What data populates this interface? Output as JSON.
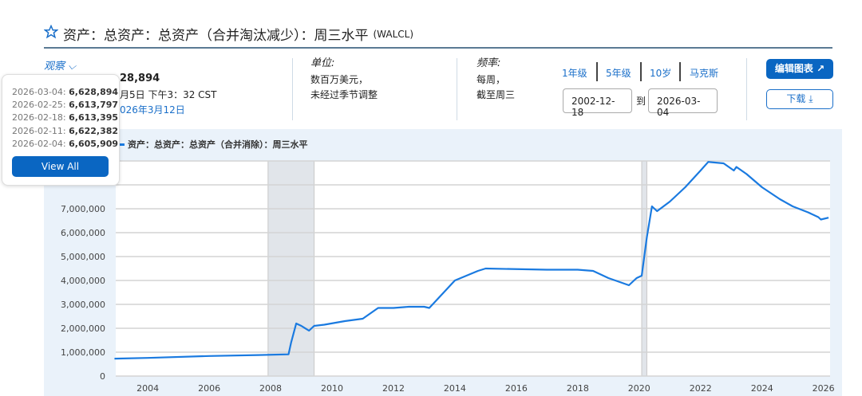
{
  "header": {
    "title": "资产：总资产：总资产（合并淘汰减少）：周三水平",
    "series_id": "(WALCL)",
    "star_icon": "star-outline-icon"
  },
  "observation": {
    "label": "观察",
    "latest_value_partial": "28,894",
    "updated_partial": "月5日 下午3：32 CST",
    "next_release_partial": "026年3月12日"
  },
  "units": {
    "label": "单位:",
    "line1": "数百万美元，",
    "line2": "未经过季节调整"
  },
  "frequency": {
    "label": "频率:",
    "line1": "每周，",
    "line2": "截至周三"
  },
  "ranges": [
    "1年级",
    "5年级",
    "10岁",
    "马克斯"
  ],
  "date_range": {
    "start": "2002-12-18",
    "to": "到",
    "end": "2026-03-04"
  },
  "buttons": {
    "edit": "编辑图表",
    "download": "下载"
  },
  "popup": {
    "rows": [
      {
        "date": "2026-03-04:",
        "value": "6,628,894"
      },
      {
        "date": "2026-02-25:",
        "value": "6,613,797"
      },
      {
        "date": "2026-02-18:",
        "value": "6,613,395"
      },
      {
        "date": "2026-02-11:",
        "value": "6,622,382"
      },
      {
        "date": "2026-02-04:",
        "value": "6,605,909"
      }
    ],
    "view_all": "View All"
  },
  "colors": {
    "accent": "#0a66c2",
    "line": "#1a7ae0",
    "recession": "#e1e5ea",
    "chart_bg": "#eaf2fa"
  },
  "chart_data": {
    "type": "line",
    "legend": "资产：总资产：总资产（合并消除）：周三水平",
    "legend_placement": "top-left",
    "grid": true,
    "xlim": [
      "2002-12",
      "2026-03"
    ],
    "ylim": [
      0,
      9000000
    ],
    "y_ticks": [
      "0",
      "1,000,000",
      "2,000,000",
      "3,000,000",
      "4,000,000",
      "5,000,000",
      "6,000,000",
      "7,000,000"
    ],
    "x_ticks": [
      "2004",
      "2006",
      "2008",
      "2010",
      "2012",
      "2014",
      "2016",
      "2018",
      "2020",
      "2022",
      "2024",
      "2026"
    ],
    "recessions": [
      [
        "2007-12",
        "2009-06"
      ],
      [
        "2020-02",
        "2020-04"
      ]
    ],
    "series": [
      {
        "points": [
          [
            "2002-12",
            730000
          ],
          [
            "2004-01",
            760000
          ],
          [
            "2006-01",
            840000
          ],
          [
            "2007-08",
            880000
          ],
          [
            "2008-08",
            910000
          ],
          [
            "2008-09",
            1400000
          ],
          [
            "2008-11",
            2200000
          ],
          [
            "2009-01",
            2100000
          ],
          [
            "2009-04",
            1900000
          ],
          [
            "2009-06",
            2100000
          ],
          [
            "2009-10",
            2150000
          ],
          [
            "2010-06",
            2300000
          ],
          [
            "2011-01",
            2400000
          ],
          [
            "2011-07",
            2850000
          ],
          [
            "2012-01",
            2850000
          ],
          [
            "2012-07",
            2900000
          ],
          [
            "2013-01",
            2900000
          ],
          [
            "2013-03",
            2850000
          ],
          [
            "2014-01",
            4000000
          ],
          [
            "2014-10",
            4400000
          ],
          [
            "2015-01",
            4500000
          ],
          [
            "2017-01",
            4450000
          ],
          [
            "2018-01",
            4450000
          ],
          [
            "2018-07",
            4400000
          ],
          [
            "2019-01",
            4100000
          ],
          [
            "2019-09",
            3800000
          ],
          [
            "2019-12",
            4100000
          ],
          [
            "2020-02",
            4200000
          ],
          [
            "2020-04",
            5800000
          ],
          [
            "2020-06",
            7100000
          ],
          [
            "2020-08",
            6900000
          ],
          [
            "2021-01",
            7300000
          ],
          [
            "2021-07",
            7900000
          ],
          [
            "2022-01",
            8600000
          ],
          [
            "2022-04",
            8960000
          ],
          [
            "2022-10",
            8900000
          ],
          [
            "2023-02",
            8600000
          ],
          [
            "2023-03",
            8750000
          ],
          [
            "2023-07",
            8450000
          ],
          [
            "2024-01",
            7900000
          ],
          [
            "2024-08",
            7400000
          ],
          [
            "2025-01",
            7100000
          ],
          [
            "2025-07",
            6850000
          ],
          [
            "2025-11",
            6650000
          ],
          [
            "2025-12",
            6550000
          ],
          [
            "2026-03",
            6628894
          ]
        ]
      }
    ]
  }
}
